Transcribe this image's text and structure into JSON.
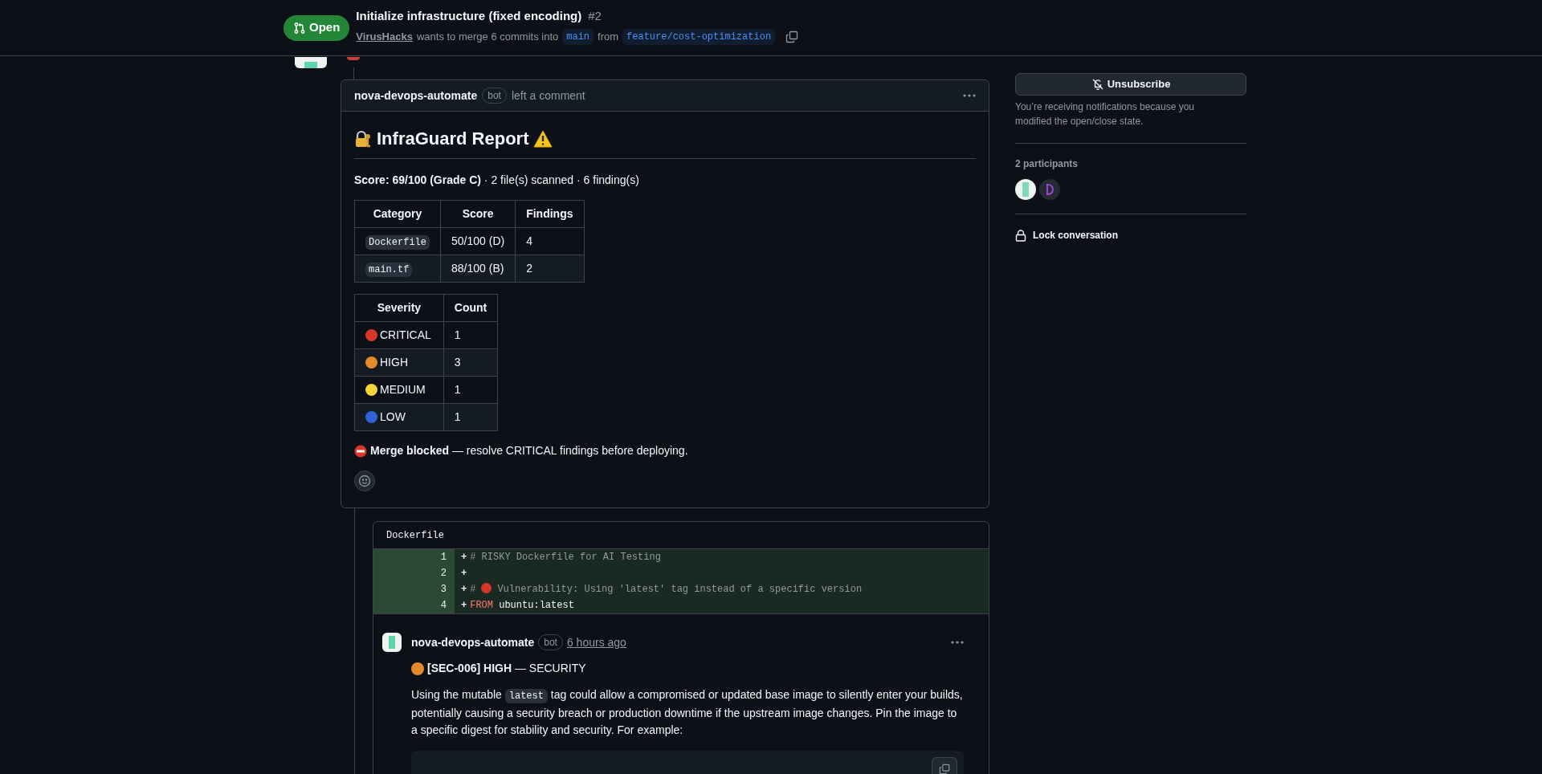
{
  "header": {
    "state": "Open",
    "title": "Initialize infrastructure (fixed encoding)",
    "number": "#2",
    "author": "VirusHacks",
    "merge_text": "wants to merge 6 commits into",
    "base": "main",
    "from_text": "from",
    "head": "feature/cost-optimization"
  },
  "report": {
    "author": "nova-devops-automate",
    "badge": "bot",
    "action": "left a comment",
    "title": "InfraGuard Report",
    "summary": "**Score: 69/100 (Grade C)** · 2 file(s) scanned · 6 finding(s)",
    "category_table": {
      "columns": [
        "Category",
        "Score",
        "Findings"
      ],
      "rows": [
        {
          "category": "Dockerfile",
          "score": "50/100 (D)",
          "findings": "4"
        },
        {
          "category": "main.tf",
          "score": "88/100 (B)",
          "findings": "2"
        }
      ]
    },
    "severity_table": {
      "columns": [
        "Severity",
        "Count"
      ],
      "rows": [
        {
          "label": "CRITICAL",
          "count": "1",
          "color": "#d7362b"
        },
        {
          "label": "HIGH",
          "count": "3",
          "color": "#e58a2c"
        },
        {
          "label": "MEDIUM",
          "count": "1",
          "color": "#f5d33a"
        },
        {
          "label": "LOW",
          "count": "1",
          "color": "#2f63d6"
        }
      ]
    },
    "verdict": "**Merge blocked** — resolve CRITICAL findings before deploying."
  },
  "diff": {
    "file": "Dockerfile",
    "lines": [
      {
        "num": "1",
        "sign": "+",
        "tokens": [
          {
            "kind": "comment",
            "text": "# RISKY Dockerfile for AI Testing"
          }
        ]
      },
      {
        "num": "2",
        "sign": "+"
      },
      {
        "num": "3",
        "sign": "+",
        "tokens": [
          {
            "kind": "comment",
            "text": "#"
          },
          {
            "kind": "dot",
            "color": "#d7362b"
          },
          {
            "kind": "comment",
            "text": "Vulnerability: Using 'latest' tag instead of a specific version"
          }
        ]
      },
      {
        "num": "4",
        "sign": "+",
        "tokens": [
          {
            "kind": "keyword",
            "text": "FROM"
          },
          {
            "kind": "plain",
            "text": "ubuntu:latest"
          }
        ]
      }
    ]
  },
  "review_comment": {
    "author": "nova-devops-automate",
    "badge": "bot",
    "time": "6 hours ago",
    "color": "#e58a2c",
    "heading": "**[SEC-006] HIGH** — SECURITY",
    "body": [
      {
        "kind": "text",
        "text": "Using the mutable "
      },
      {
        "kind": "code",
        "text": "latest"
      },
      {
        "kind": "text",
        "text": " tag could allow a compromised or updated base image to silently enter your builds, potentially causing a security breach or production downtime if the upstream image changes. Pin the image to a specific digest for stability and security. For example:"
      }
    ]
  },
  "sidebar": {
    "unsubscribe": "Unsubscribe",
    "notice": "You’re receiving notifications because you modified the open/close state.",
    "participants_label": "2 participants",
    "lock": "Lock conversation"
  }
}
